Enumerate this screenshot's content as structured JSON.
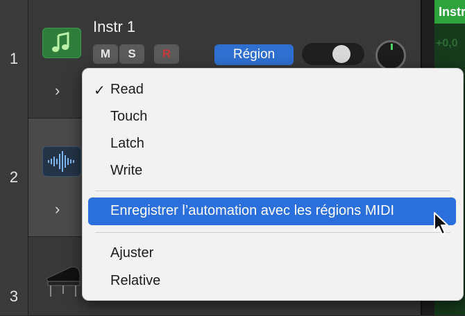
{
  "tracks": [
    {
      "number": "1",
      "name": "Instr 1",
      "icon": "music-note-icon",
      "color": "#2f7d3a"
    },
    {
      "number": "2",
      "icon": "waveform-icon",
      "color": "#243447"
    },
    {
      "number": "3",
      "icon": "grand-piano-icon"
    }
  ],
  "track_controls": {
    "mute": "M",
    "solo": "S",
    "record": "R",
    "region_mode": "Région"
  },
  "region": {
    "label": "Instr",
    "value": "+0,0",
    "color": "#2ea33c"
  },
  "menu": {
    "items": [
      {
        "label": "Read",
        "checked": true
      },
      {
        "label": "Touch"
      },
      {
        "label": "Latch"
      },
      {
        "label": "Write"
      },
      {
        "label": "Enregistrer l’automation avec les régions MIDI",
        "highlighted": true
      },
      {
        "label": "Ajuster"
      },
      {
        "label": "Relative"
      }
    ],
    "check_glyph": "✓"
  }
}
